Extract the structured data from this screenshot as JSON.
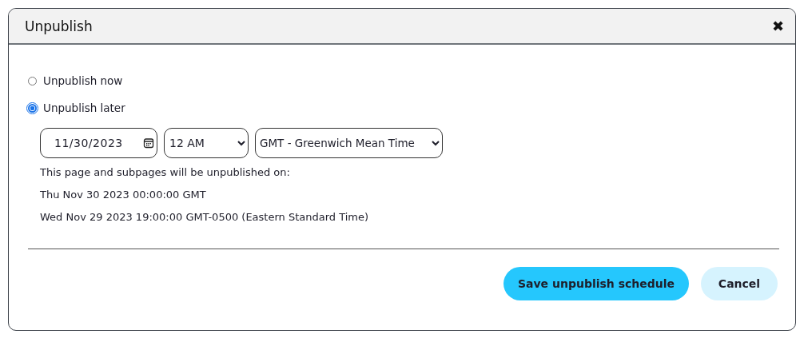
{
  "dialog": {
    "title": "Unpublish",
    "close": "✖"
  },
  "options": [
    {
      "label": "Unpublish now",
      "selected": false
    },
    {
      "label": "Unpublish later",
      "selected": true
    }
  ],
  "schedule": {
    "date": "11/30/2023",
    "time": "12 AM",
    "timezone": "GMT - Greenwich Mean Time",
    "lines": [
      "This page and subpages will be unpublished on:",
      "Thu Nov 30 2023 00:00:00 GMT",
      "Wed Nov 29 2023 19:00:00 GMT-0500 (Eastern Standard Time)"
    ]
  },
  "buttons": [
    {
      "kind": "primary",
      "label": "Save unpublish schedule"
    },
    {
      "kind": "secondary",
      "label": "Cancel"
    }
  ]
}
